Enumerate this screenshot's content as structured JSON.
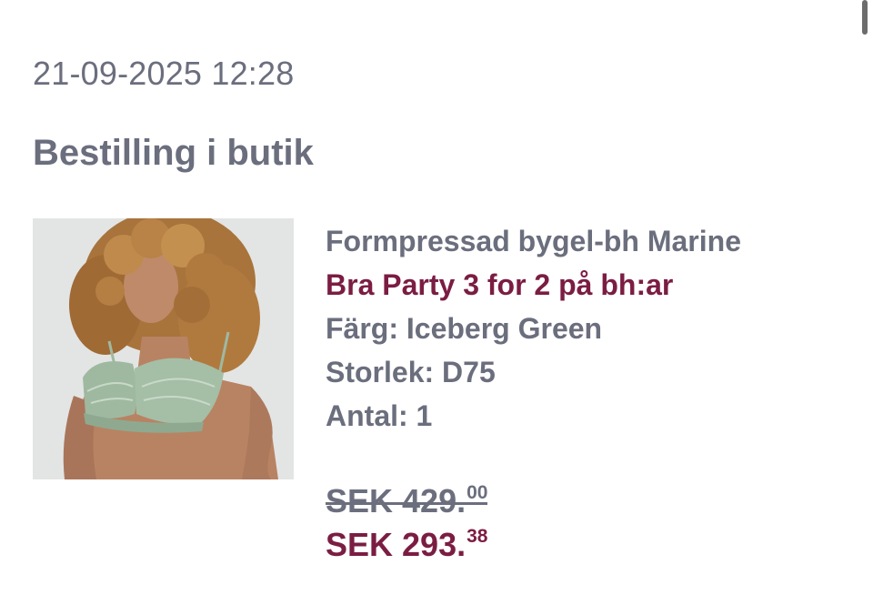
{
  "order": {
    "timestamp": "21-09-2025 12:28",
    "title": "Bestilling i butik"
  },
  "product": {
    "image_icon": "product-photo-bra",
    "name": "Formpressad bygel-bh Marine",
    "promotion": "Bra Party 3 for 2 på bh:ar",
    "color_line": "Färg: Iceberg Green",
    "size_line": "Storlek: D75",
    "quantity_line": "Antal: 1"
  },
  "price": {
    "original_main": "SEK 429.",
    "original_cents": "00",
    "discounted_main": "SEK 293.",
    "discounted_cents": "38"
  },
  "colors": {
    "text_gray": "#6b6e7d",
    "accent_wine": "#7b1d43",
    "bra_green": "#9fb9a0"
  }
}
